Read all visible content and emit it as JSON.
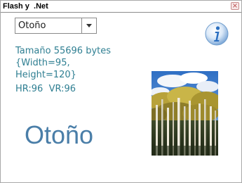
{
  "window": {
    "title": "Flash y  .Net",
    "close_glyph": "×"
  },
  "season_select": {
    "selected": "Otoño"
  },
  "image_info": {
    "size_line": "Tamaño 55696 bytes",
    "width_line": "{Width=95,",
    "height_line": "Height=120}",
    "resolution_line": "HR:96  VR:96"
  },
  "season_label": "Otoño",
  "icons": {
    "info": "info-icon",
    "dropdown": "chevron-down-icon",
    "close": "close-icon"
  },
  "colors": {
    "info_text": "#2f7f92",
    "season_label": "#4a7ea8",
    "info_icon": "#2b6fc0"
  }
}
